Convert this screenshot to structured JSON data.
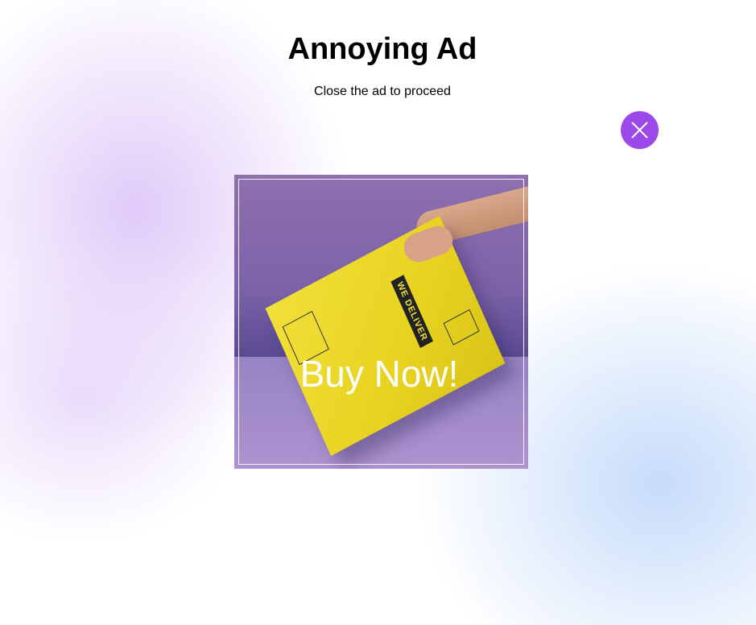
{
  "header": {
    "title": "Annoying Ad",
    "subtitle": "Close the ad to proceed"
  },
  "close_button": {
    "icon": "close-icon",
    "color": "#9b49e8"
  },
  "ad": {
    "cta": "Buy Now!",
    "package_text": "WE DELIVER"
  }
}
